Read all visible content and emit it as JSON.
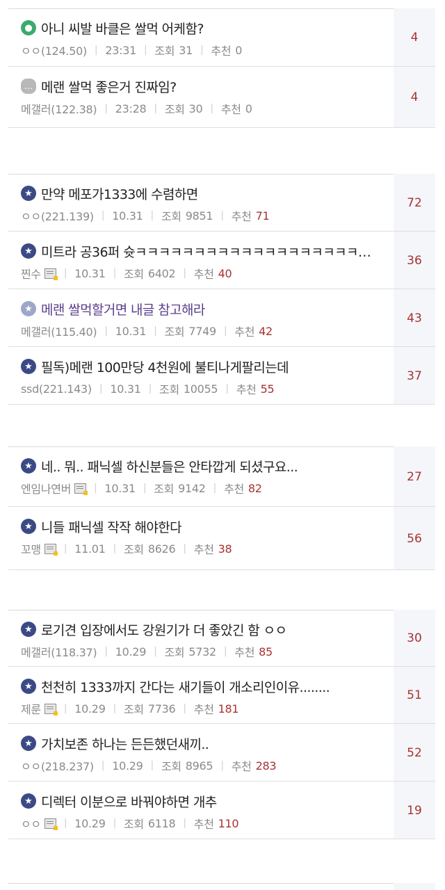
{
  "groups": [
    {
      "posts": [
        {
          "icon": "user-icon",
          "title": "아니 씨발 바클은 쌀먹 어케함?",
          "author": "ㅇㅇ(124.50)",
          "gallog": false,
          "date": "23:31",
          "views_label": "조회",
          "views": "31",
          "rec_label": "추천",
          "rec": "0",
          "comments": "4",
          "visited": false
        },
        {
          "icon": "chat-icon",
          "title": "메랜 쌀먹 좋은거 진짜임?",
          "author": "메갤러(122.38)",
          "gallog": false,
          "date": "23:28",
          "views_label": "조회",
          "views": "30",
          "rec_label": "추천",
          "rec": "0",
          "comments": "4",
          "visited": false
        }
      ]
    },
    {
      "posts": [
        {
          "icon": "star-icon",
          "title": "만약 메포가1333에 수렴하면",
          "author": "ㅇㅇ(221.139)",
          "gallog": false,
          "date": "10.31",
          "views_label": "조회",
          "views": "9851",
          "rec_label": "추천",
          "rec": "71",
          "comments": "72",
          "visited": false
        },
        {
          "icon": "star-icon",
          "title": "미트라 공36퍼 슛ㅋㅋㅋㅋㅋㅋㅋㅋㅋㅋㅋㅋㅋㅋㅋㅋㅋㅋㅋㅋㅋㅋ...",
          "author": "찐수",
          "gallog": true,
          "date": "10.31",
          "views_label": "조회",
          "views": "6402",
          "rec_label": "추천",
          "rec": "40",
          "comments": "36",
          "visited": false
        },
        {
          "icon": "star-icon",
          "title": "메랜 쌀먹할거면 내글 참고해라",
          "author": "메갤러(115.40)",
          "gallog": false,
          "date": "10.31",
          "views_label": "조회",
          "views": "7749",
          "rec_label": "추천",
          "rec": "42",
          "comments": "43",
          "visited": true
        },
        {
          "icon": "star-icon",
          "title": "필독)메랜 100만당 4천원에 불티나게팔리는데",
          "author": "ssd(221.143)",
          "gallog": false,
          "date": "10.31",
          "views_label": "조회",
          "views": "10055",
          "rec_label": "추천",
          "rec": "55",
          "comments": "37",
          "visited": false
        }
      ]
    },
    {
      "posts": [
        {
          "icon": "star-icon",
          "title": "네.. 뭐.. 패닉셀 하신분들은 안타깝게 되셨구요...",
          "author": "엔임나연버",
          "gallog": true,
          "date": "10.31",
          "views_label": "조회",
          "views": "9142",
          "rec_label": "추천",
          "rec": "82",
          "comments": "27",
          "visited": false
        },
        {
          "icon": "star-icon",
          "title": "니들 패닉셀 작작 해야한다",
          "author": "꼬맹",
          "gallog": true,
          "date": "11.01",
          "views_label": "조회",
          "views": "8626",
          "rec_label": "추천",
          "rec": "38",
          "comments": "56",
          "visited": false
        }
      ]
    },
    {
      "posts": [
        {
          "icon": "star-icon",
          "title": "로기견 입장에서도 강원기가 더 좋았긴 함 ㅇㅇ",
          "author": "메갤러(118.37)",
          "gallog": false,
          "date": "10.29",
          "views_label": "조회",
          "views": "5732",
          "rec_label": "추천",
          "rec": "85",
          "comments": "30",
          "visited": false
        },
        {
          "icon": "star-icon",
          "title": "천천히 1333까지 간다는 새기들이 개소리인이유........",
          "author": "제룬",
          "gallog": true,
          "date": "10.29",
          "views_label": "조회",
          "views": "7736",
          "rec_label": "추천",
          "rec": "181",
          "comments": "51",
          "visited": false
        },
        {
          "icon": "star-icon",
          "title": "가치보존 하나는 든든했던새끼..",
          "author": "ㅇㅇ(218.237)",
          "gallog": false,
          "date": "10.29",
          "views_label": "조회",
          "views": "8965",
          "rec_label": "추천",
          "rec": "283",
          "comments": "52",
          "visited": false
        },
        {
          "icon": "star-icon",
          "title": "디렉터 이분으로 바꿔야하면 개추",
          "author": "ㅇㅇ",
          "gallog": true,
          "date": "10.29",
          "views_label": "조회",
          "views": "6118",
          "rec_label": "추천",
          "rec": "110",
          "comments": "19",
          "visited": false
        }
      ]
    }
  ],
  "colors": {
    "title": "#222222",
    "visited_title": "#5b3e8c",
    "meta": "#8a8a8a",
    "recommend": "#a83232",
    "comment_count": "#a83232",
    "comment_column_bg": "#f4f6fa",
    "star_icon_bg": "#3b4a86",
    "visited_icon_bg": "#9ea7c9",
    "user_icon_bg": "#3bab6b",
    "chat_icon_bg": "#b8b8b8"
  }
}
